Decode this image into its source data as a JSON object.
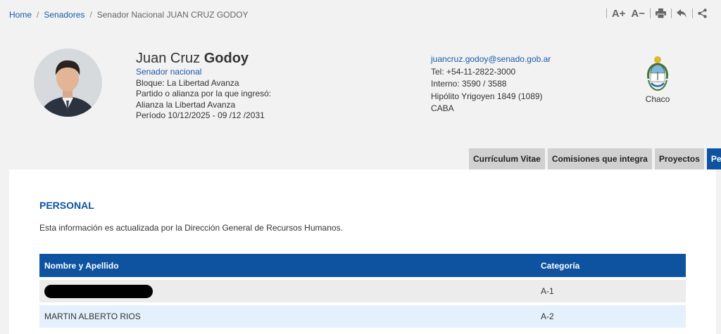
{
  "breadcrumb": {
    "home": "Home",
    "senadores": "Senadores",
    "current": "Senador Nacional JUAN CRUZ GODOY"
  },
  "toolbar": {
    "font_increase": "A+",
    "font_decrease": "A−",
    "icons": [
      "font-increase-icon",
      "font-decrease-icon",
      "print-icon",
      "back-icon",
      "share-icon"
    ]
  },
  "senator": {
    "first_name": "Juan Cruz",
    "last_name": "Godoy",
    "role": "Senador nacional",
    "bloque": "Bloque: La Libertad Avanza",
    "partido_label": "Partido o alianza por la que ingresó:",
    "partido": "Alianza la Libertad Avanza",
    "periodo": "Período 10/12/2025 - 09 /12 /2031"
  },
  "contact": {
    "email": "juancruz.godoy@senado.gob.ar",
    "tel": "Tel: +54-11-2822-3000",
    "interno": "Interno: 3590 / 3588",
    "address": "Hipólito Yrigoyen 1849 (1089)",
    "city": "CABA"
  },
  "province": {
    "name": "Chaco"
  },
  "tabs": [
    {
      "label": "Currículum Vitae",
      "active": false
    },
    {
      "label": "Comisiones que integra",
      "active": false
    },
    {
      "label": "Proyectos",
      "active": false
    },
    {
      "label": "Personal",
      "active": true
    }
  ],
  "personal": {
    "title": "PERSONAL",
    "description": "Esta información es actualizada por la Dirección General de Recursos Humanos.",
    "headers": {
      "name": "Nombre y Apellido",
      "category": "Categoría"
    },
    "rows": [
      {
        "name": "",
        "redacted": true,
        "category": "A-1"
      },
      {
        "name": "MARTIN ALBERTO RIOS",
        "redacted": false,
        "category": "A-2"
      }
    ]
  },
  "colors": {
    "primary": "#0d53a0",
    "link": "#1a5aa8",
    "tab_inactive": "#d0d0d0"
  }
}
